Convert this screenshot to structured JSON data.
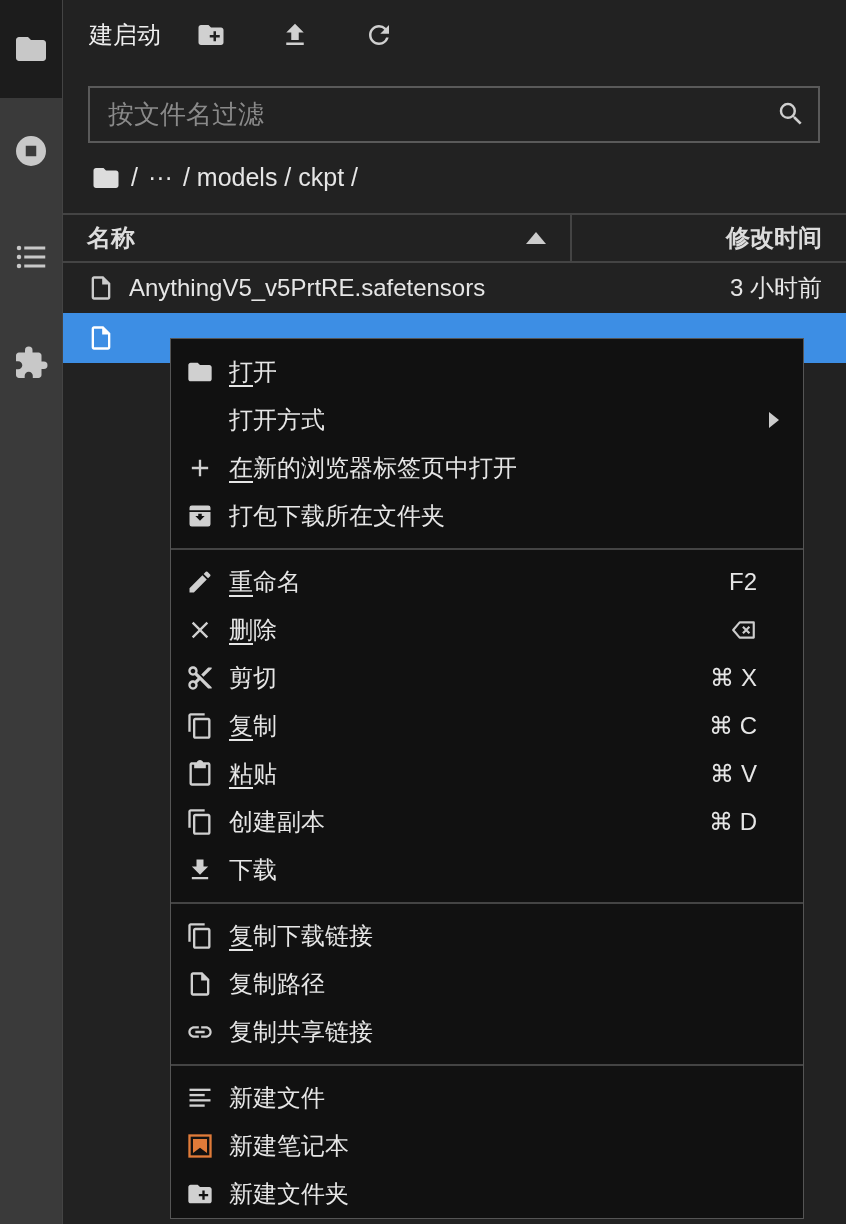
{
  "sidebar": {
    "tabs": [
      {
        "selected": true
      },
      {
        "selected": false
      },
      {
        "selected": false
      },
      {
        "selected": false
      }
    ]
  },
  "toolbar": {
    "launcher_label": "建启动"
  },
  "filter": {
    "placeholder": "按文件名过滤"
  },
  "breadcrumb": [
    "/",
    "···",
    "/ models / ckpt /"
  ],
  "table": {
    "columns": [
      {
        "label": "名称",
        "sorted": true
      },
      {
        "label": "修改时间",
        "sorted": false
      }
    ],
    "rows": [
      {
        "name": "AnythingV5_v5PrtRE.safetensors",
        "modified": "3 小时前",
        "selected": false
      },
      {
        "selected": true
      }
    ]
  },
  "context_menu": {
    "groups": [
      [
        {
          "label": "打开",
          "underline_first": true
        },
        {
          "label": "打开方式",
          "submenu": true
        },
        {
          "label": "在新的浏览器标签页中打开",
          "underline_first": true
        },
        {
          "label": "打包下载所在文件夹"
        }
      ],
      [
        {
          "label": "重命名",
          "underline_first": true,
          "shortcut": "F2"
        },
        {
          "label": "删除",
          "underline_first": true,
          "shortcut_icon": true
        },
        {
          "label": "剪切",
          "shortcut": "⌘ X"
        },
        {
          "label": "复制",
          "underline_first": true,
          "shortcut": "⌘ C"
        },
        {
          "label": "粘贴",
          "underline_first": true,
          "shortcut": "⌘ V"
        },
        {
          "label": "创建副本",
          "shortcut": "⌘ D"
        },
        {
          "label": "下载"
        }
      ],
      [
        {
          "label": "复制下载链接",
          "underline_first": true
        },
        {
          "label": "复制路径"
        },
        {
          "label": "复制共享链接"
        }
      ],
      [
        {
          "label": "新建文件"
        },
        {
          "label": "新建笔记本"
        },
        {
          "label": "新建文件夹"
        }
      ]
    ]
  }
}
